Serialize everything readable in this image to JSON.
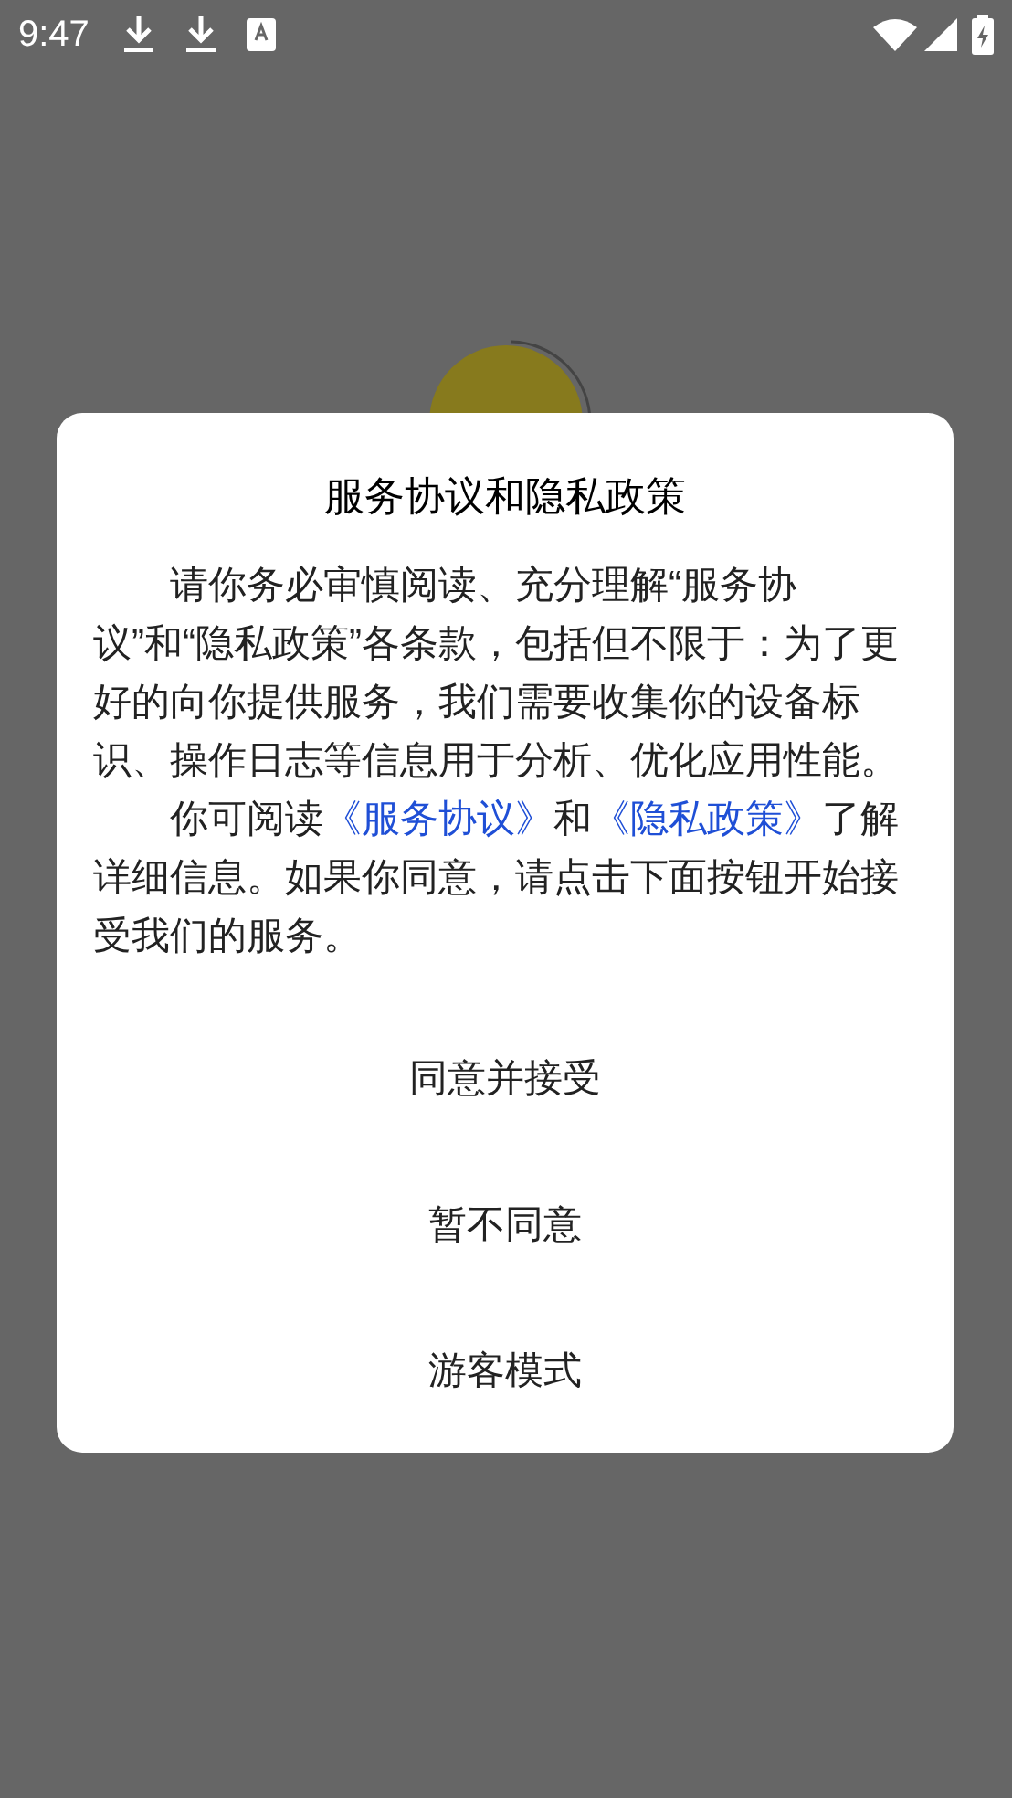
{
  "status_bar": {
    "time": "9:47"
  },
  "dialog": {
    "title": "服务协议和隐私政策",
    "paragraphs": [
      [
        {
          "kind": "text",
          "text": "请你务必审慎阅读、充分理解“服务协议”和“隐私政策”各条款，包括但不限于：为了更好的向你提供服务，我们需要收集你的设备标识、操作日志等信息用于分析、优化应用性能。"
        }
      ],
      [
        {
          "kind": "text",
          "text": "你可阅读"
        },
        {
          "kind": "link",
          "text": "《服务协议》"
        },
        {
          "kind": "text",
          "text": "和"
        },
        {
          "kind": "link",
          "text": "《隐私政策》"
        },
        {
          "kind": "text",
          "text": "了解详细信息。如果你同意，请点击下面按钮开始接受我们的服务。"
        }
      ]
    ],
    "buttons": [
      "同意并接受",
      "暂不同意",
      "游客模式"
    ]
  }
}
